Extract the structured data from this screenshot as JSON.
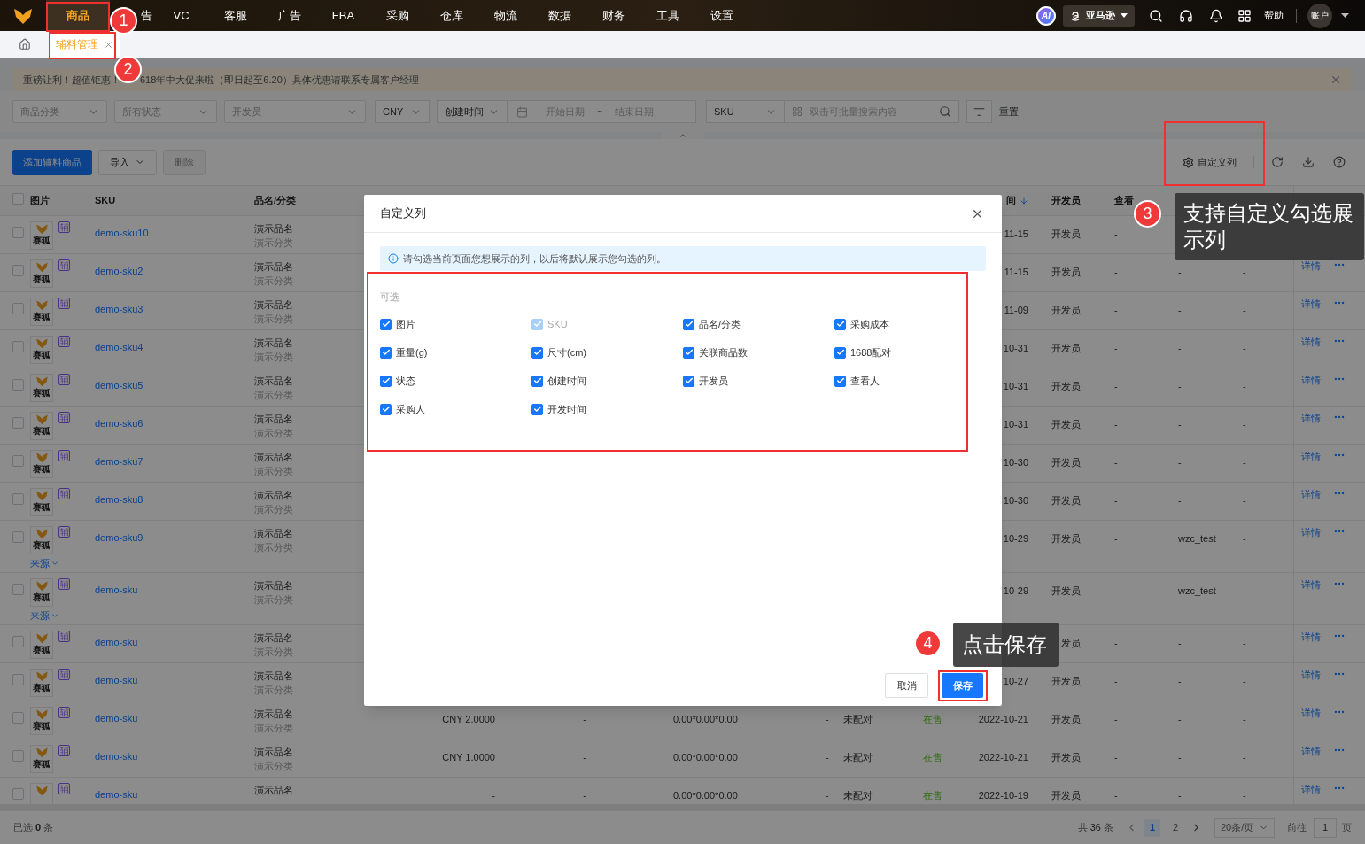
{
  "top_nav": {
    "items": [
      {
        "label": "商品",
        "selected": true
      },
      {
        "label": "告",
        "selected": false
      },
      {
        "label": "VC",
        "selected": false
      },
      {
        "label": "客服",
        "selected": false
      },
      {
        "label": "广告",
        "selected": false
      },
      {
        "label": "FBA",
        "selected": false
      },
      {
        "label": "采购",
        "selected": false
      },
      {
        "label": "仓库",
        "selected": false
      },
      {
        "label": "物流",
        "selected": false
      },
      {
        "label": "数据",
        "selected": false
      },
      {
        "label": "财务",
        "selected": false
      },
      {
        "label": "工具",
        "selected": false
      },
      {
        "label": "设置",
        "selected": false
      }
    ],
    "ai_badge": "AI",
    "store_selector": "亚马逊",
    "help": "帮助",
    "account": "账户"
  },
  "tabs": [
    {
      "label": "辅料管理",
      "selected": true
    }
  ],
  "banner": {
    "text_before": "重磅让利！超值钜惠！",
    "text_after": "618年中大促来啦（即日起至6.20）具体优惠请联系专属客户经理"
  },
  "filters": {
    "category": "商品分类",
    "status": "所有状态",
    "developer": "开发员",
    "currency": "CNY",
    "date_type": "创建时间",
    "start_date": "开始日期",
    "range_sep": "~",
    "end_date": "结束日期",
    "search_field": "SKU",
    "search_placeholder": "双击可批量搜索内容",
    "reset": "重置"
  },
  "toolbar": {
    "buttons": [
      {
        "label": "添加辅料商品",
        "kind": "primary",
        "disabled": false
      },
      {
        "label": "导入",
        "kind": "dropdown",
        "disabled": false
      },
      {
        "label": "删除",
        "kind": "plain",
        "disabled": true
      }
    ],
    "custom_columns": "自定义列"
  },
  "table": {
    "header_checked": false,
    "columns": {
      "image": "图片",
      "sku": "SKU",
      "name": "品名/分类",
      "created": "间",
      "developer": "开发员",
      "viewer": "查看"
    },
    "rows": [
      {
        "selected": false,
        "thumb_text": "赛狐",
        "tag": "辅",
        "sku": "demo-sku10",
        "name": "演示品名",
        "category": "演示分类",
        "created": "11-15",
        "developer": "开发员",
        "viewer": "-"
      },
      {
        "selected": false,
        "thumb_text": "赛狐",
        "tag": "辅",
        "sku": "demo-sku2",
        "name": "演示品名",
        "category": "演示分类",
        "created": "11-15",
        "developer": "开发员",
        "viewer": "-",
        "buyer": "-",
        "dev_time": "-",
        "action": "详情"
      },
      {
        "selected": false,
        "thumb_text": "赛狐",
        "tag": "辅",
        "sku": "demo-sku3",
        "name": "演示品名",
        "category": "演示分类",
        "created": "11-09",
        "developer": "开发员",
        "viewer": "-",
        "buyer": "-",
        "dev_time": "-",
        "action": "详情"
      },
      {
        "selected": false,
        "thumb_text": "赛狐",
        "tag": "辅",
        "sku": "demo-sku4",
        "name": "演示品名",
        "category": "演示分类",
        "created": "10-31",
        "developer": "开发员",
        "viewer": "-",
        "buyer": "-",
        "dev_time": "-",
        "action": "详情"
      },
      {
        "selected": false,
        "thumb_text": "赛狐",
        "tag": "辅",
        "sku": "demo-sku5",
        "name": "演示品名",
        "category": "演示分类",
        "created": "10-31",
        "developer": "开发员",
        "viewer": "-",
        "buyer": "-",
        "dev_time": "-",
        "action": "详情"
      },
      {
        "selected": false,
        "thumb_text": "赛狐",
        "tag": "辅",
        "sku": "demo-sku6",
        "name": "演示品名",
        "category": "演示分类",
        "created": "10-31",
        "developer": "开发员",
        "viewer": "-",
        "buyer": "-",
        "dev_time": "-",
        "action": "详情"
      },
      {
        "selected": false,
        "thumb_text": "赛狐",
        "tag": "辅",
        "sku": "demo-sku7",
        "name": "演示品名",
        "category": "演示分类",
        "created": "10-30",
        "developer": "开发员",
        "viewer": "-",
        "buyer": "-",
        "dev_time": "-",
        "action": "详情"
      },
      {
        "selected": false,
        "thumb_text": "赛狐",
        "tag": "辅",
        "sku": "demo-sku8",
        "name": "演示品名",
        "category": "演示分类",
        "created": "10-30",
        "developer": "开发员",
        "viewer": "-",
        "buyer": "-",
        "dev_time": "-",
        "action": "详情"
      },
      {
        "selected": false,
        "thumb_text": "赛狐",
        "tag": "辅",
        "source": "来源",
        "sku": "demo-sku9",
        "name": "演示品名",
        "category": "演示分类",
        "created": "10-29",
        "developer": "开发员",
        "viewer": "-",
        "buyer": "wzc_test",
        "dev_time": "-",
        "action": "详情"
      },
      {
        "selected": false,
        "thumb_text": "赛狐",
        "tag": "辅",
        "source": "来源",
        "sku": "demo-sku",
        "name": "演示品名",
        "category": "演示分类",
        "created": "10-29",
        "developer": "开发员",
        "viewer": "-",
        "buyer": "wzc_test",
        "dev_time": "-",
        "action": "详情"
      },
      {
        "selected": false,
        "thumb_text": "赛狐",
        "tag": "辅",
        "sku": "demo-sku",
        "name": "演示品名",
        "category": "演示分类",
        "developer": "发员",
        "viewer": "-",
        "buyer": "-",
        "dev_time": "-",
        "action": "详情"
      },
      {
        "selected": false,
        "thumb_text": "赛狐",
        "tag": "辅",
        "sku": "demo-sku",
        "name": "演示品名",
        "category": "演示分类",
        "created": "10-27",
        "developer": "开发员",
        "viewer": "-",
        "buyer": "-",
        "dev_time": "-",
        "action": "详情"
      },
      {
        "selected": false,
        "thumb_text": "赛狐",
        "tag": "辅",
        "sku": "demo-sku",
        "name": "演示品名",
        "category": "演示分类",
        "column_4": "CNY 2.0000",
        "column_5": "-",
        "column_6": "0.00*0.00*0.00",
        "column_7": "-",
        "column_8": "未配对",
        "column_9": "在售",
        "created": "2022-10-21",
        "developer": "开发员",
        "viewer": "-",
        "buyer": "-",
        "dev_time": "-",
        "action": "详情"
      },
      {
        "selected": false,
        "thumb_text": "赛狐",
        "tag": "辅",
        "sku": "demo-sku",
        "name": "演示品名",
        "category": "演示分类",
        "column_4": "CNY 1.0000",
        "column_5": "-",
        "column_6": "0.00*0.00*0.00",
        "column_7": "-",
        "column_8": "未配对",
        "column_9": "在售",
        "created": "2022-10-21",
        "developer": "开发员",
        "viewer": "-",
        "buyer": "-",
        "dev_time": "-",
        "action": "详情"
      },
      {
        "selected": false,
        "tag": "辅",
        "sku": "demo-sku",
        "name": "演示品名",
        "column_4": "-",
        "column_5": "-",
        "column_6": "0.00*0.00*0.00",
        "column_7": "-",
        "column_8": "未配对",
        "column_9": "在售",
        "created": "2022-10-19",
        "developer": "开发员",
        "viewer": "-",
        "buyer": "-",
        "dev_time": "-",
        "action": "详情"
      }
    ]
  },
  "footer": {
    "selected_prefix": "已选",
    "selected_count": "0",
    "selected_suffix": "条",
    "total_prefix": "共",
    "total": "36",
    "total_suffix": "条",
    "pages": [
      {
        "label": "1",
        "selected": true
      },
      {
        "label": "2",
        "selected": false
      }
    ],
    "page_size": "20条/页",
    "goto_label": "前往",
    "goto_value": "1",
    "goto_suffix": "页"
  },
  "dialog": {
    "title": "自定义列",
    "notice": "请勾选当前页面您想展示的列，以后将默认展示您勾选的列。",
    "group_label": "可选",
    "columns": [
      {
        "label": "图片",
        "checked": true,
        "disabled": false
      },
      {
        "label": "SKU",
        "checked": true,
        "disabled": true
      },
      {
        "label": "品名/分类",
        "checked": true,
        "disabled": false
      },
      {
        "label": "采购成本",
        "checked": true,
        "disabled": false
      },
      {
        "label": "重量(g)",
        "checked": true,
        "disabled": false
      },
      {
        "label": "尺寸(cm)",
        "checked": true,
        "disabled": false
      },
      {
        "label": "关联商品数",
        "checked": true,
        "disabled": false
      },
      {
        "label": "1688配对",
        "checked": true,
        "disabled": false
      },
      {
        "label": "状态",
        "checked": true,
        "disabled": false
      },
      {
        "label": "创建时间",
        "checked": true,
        "disabled": false
      },
      {
        "label": "开发员",
        "checked": true,
        "disabled": false
      },
      {
        "label": "查看人",
        "checked": true,
        "disabled": false
      },
      {
        "label": "采购人",
        "checked": true,
        "disabled": false
      },
      {
        "label": "开发时间",
        "checked": true,
        "disabled": false
      }
    ],
    "cancel": "取消",
    "save": "保存"
  },
  "callouts": [
    {
      "number": "1"
    },
    {
      "number": "2"
    },
    {
      "number": "3",
      "text": "支持自定义勾选展示列"
    },
    {
      "number": "4",
      "text": "点击保存"
    }
  ]
}
